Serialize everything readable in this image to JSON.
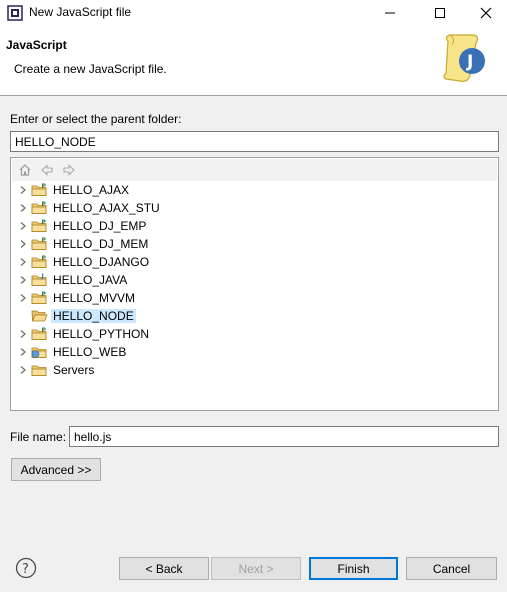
{
  "window": {
    "title": "New JavaScript file",
    "minimize_icon": "minimize-icon",
    "maximize_icon": "maximize-icon",
    "close_icon": "close-icon"
  },
  "banner": {
    "title": "JavaScript",
    "description": "Create a new JavaScript file.",
    "icon": "javascript-wizard-icon"
  },
  "folder": {
    "label": "Enter or select the parent folder:",
    "value": "HELLO_NODE"
  },
  "tree": {
    "toolbar": [
      "home-icon",
      "back-arrow-icon",
      "forward-arrow-icon"
    ],
    "items": [
      {
        "label": "HELLO_AJAX",
        "icon": "project-folder-icon",
        "selected": false
      },
      {
        "label": "HELLO_AJAX_STU",
        "icon": "project-folder-icon",
        "selected": false
      },
      {
        "label": "HELLO_DJ_EMP",
        "icon": "project-folder-icon",
        "selected": false
      },
      {
        "label": "HELLO_DJ_MEM",
        "icon": "project-folder-icon",
        "selected": false
      },
      {
        "label": "HELLO_DJANGO",
        "icon": "project-folder-icon",
        "selected": false
      },
      {
        "label": "HELLO_JAVA",
        "icon": "java-project-icon",
        "selected": false
      },
      {
        "label": "HELLO_MVVM",
        "icon": "project-folder-icon",
        "selected": false
      },
      {
        "label": "HELLO_NODE",
        "icon": "open-folder-icon",
        "selected": true
      },
      {
        "label": "HELLO_PYTHON",
        "icon": "project-folder-icon",
        "selected": false
      },
      {
        "label": "HELLO_WEB",
        "icon": "web-project-icon",
        "selected": false
      },
      {
        "label": "Servers",
        "icon": "folder-icon",
        "selected": false
      }
    ]
  },
  "file": {
    "label": "File name:",
    "value": "hello.js"
  },
  "buttons": {
    "advanced": "Advanced >>",
    "back": "< Back",
    "next": "Next >",
    "finish": "Finish",
    "cancel": "Cancel"
  },
  "colors": {
    "selection": "#cce8ff",
    "default_button_border": "#0078d7"
  }
}
